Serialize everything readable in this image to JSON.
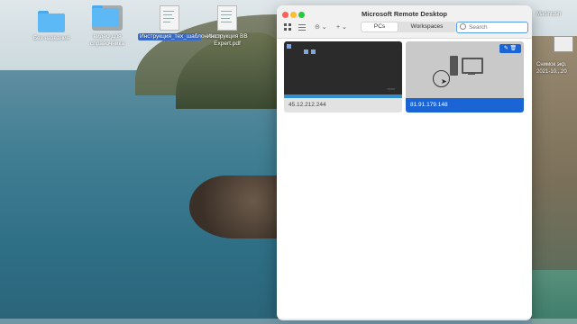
{
  "desktop": {
    "items": [
      {
        "label": "Без названия"
      },
      {
        "label": "видео для справочника"
      },
      {
        "label": "Инструкция_тех_шаблон.docx"
      },
      {
        "label": "Инструкция BB Expert.pdf"
      }
    ],
    "right_items": [
      {
        "label": "Снимок экр."
      },
      {
        "label": "2021-10...20"
      },
      {
        "label": "Macintosh"
      }
    ]
  },
  "window": {
    "title": "Microsoft Remote Desktop",
    "toolbar": {
      "grid_icon": "grid-view-icon",
      "list_icon": "list-view-icon",
      "more_label": "⊝ ⌄",
      "add_label": "+ ⌄"
    },
    "tabs": {
      "pcs": "PCs",
      "workspaces": "Workspaces"
    },
    "search": {
      "placeholder": "Search"
    },
    "pcs": [
      {
        "name": "45.12.212.244",
        "selected": false
      },
      {
        "name": "81.91.179.148",
        "selected": true
      }
    ],
    "tile_actions": {
      "edit": "✎ 🗑"
    }
  },
  "colors": {
    "accent": "#1a64d6",
    "search_border": "#5a9be6"
  }
}
